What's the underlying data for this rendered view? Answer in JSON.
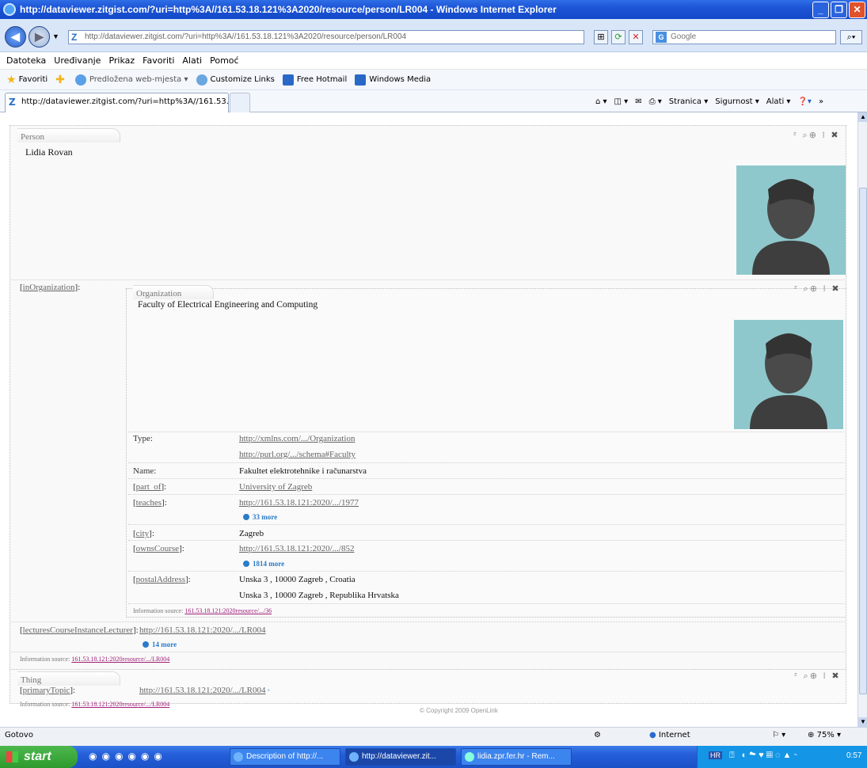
{
  "window": {
    "title": "http://dataviewer.zitgist.com/?uri=http%3A//161.53.18.121%3A2020/resource/person/LR004 - Windows Internet Explorer"
  },
  "address": {
    "url": "http://dataviewer.zitgist.com/?uri=http%3A//161.53.18.121%3A2020/resource/person/LR004",
    "search_placeholder": "Google"
  },
  "menu": [
    "Datoteka",
    "Uređivanje",
    "Prikaz",
    "Favoriti",
    "Alati",
    "Pomoć"
  ],
  "favorites": {
    "label": "Favoriti",
    "items": [
      "Predložena web-mjesta ▾",
      "Customize Links",
      "Free Hotmail",
      "Windows Media"
    ]
  },
  "tab": {
    "label": "http://dataviewer.zitgist.com/?uri=http%3A//161.53..."
  },
  "commands": [
    "Stranica ▾",
    "Sigurnost ▾",
    "Alati ▾"
  ],
  "person": {
    "type_label": "Person",
    "name": "Lidia Rovan"
  },
  "organization": {
    "prop_label": "inOrganization",
    "type_label": "Organization",
    "name": "Faculty of Electrical Engineering and Computing",
    "rows": [
      {
        "label": "Type:",
        "link": false,
        "values": [
          "http://xmlns.com/.../Organization",
          "http://purl.org/.../schema#Faculty"
        ],
        "value_links": true
      },
      {
        "label": "Name:",
        "link": false,
        "values": [
          "Fakultet elektrotehnike i računarstva"
        ],
        "value_links": false
      },
      {
        "label": "part_of",
        "link": true,
        "values": [
          "University of Zagreb"
        ],
        "value_links": true
      },
      {
        "label": "teaches",
        "link": true,
        "values": [
          "http://161.53.18.121:2020/.../1977"
        ],
        "value_links": true,
        "more": "33 more"
      },
      {
        "label": "city",
        "link": true,
        "values": [
          "Zagreb"
        ],
        "value_links": false
      },
      {
        "label": "ownsCourse",
        "link": true,
        "values": [
          "http://161.53.18.121:2020/.../852"
        ],
        "value_links": true,
        "more": "1814 more"
      },
      {
        "label": "postalAddress",
        "link": true,
        "values": [
          "Unska 3 , 10000 Zagreb , Croatia",
          "Unska 3 , 10000 Zagreb , Republika Hrvatska"
        ],
        "value_links": false
      }
    ],
    "source_label": "Information source:",
    "source_link": "161.53.18.121:2020resource/.../36"
  },
  "lectures": {
    "prop_label": "lecturesCourseInstanceLecturer",
    "value": "http://161.53.18.121:2020/.../LR004",
    "more": "14 more"
  },
  "person_source": {
    "label": "Information source:",
    "link": "161.53.18.121:2020resource/.../LR004"
  },
  "thing": {
    "type_label": "Thing",
    "prop_label": "primaryTopic",
    "value": "http://161.53.18.121:2020/.../LR004",
    "source_label": "Information source:",
    "source_link": "161.53.18.121:2020resource/.../LR004"
  },
  "copyright": "© Copyright 2009 OpenLink",
  "status": {
    "left": "Gotovo",
    "zone": "Internet",
    "zoom": "75%"
  },
  "taskbar": {
    "start": "start",
    "apps": [
      "Description of http://...",
      "http://dataviewer.zit...",
      "lidia.zpr.fer.hr - Rem..."
    ],
    "lang": "HR",
    "clock": "0:57"
  }
}
